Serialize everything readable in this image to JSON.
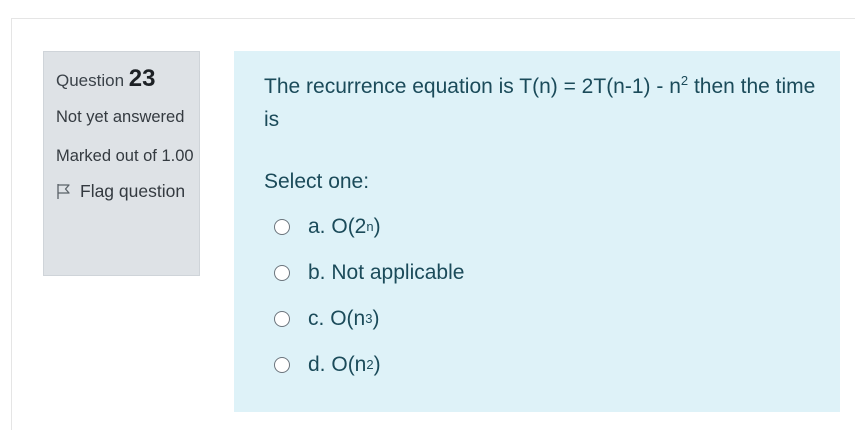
{
  "info": {
    "question_label": "Question",
    "question_number": "23",
    "state": "Not yet answered",
    "grade": "Marked out of 1.00",
    "flag_label": "Flag question"
  },
  "question": {
    "text_before": "The recurrence equation is T(n) = 2T(n-1) - n",
    "text_exponent": "2",
    "text_after": " then the time is",
    "prompt": "Select one:",
    "options": [
      {
        "letter": "a.",
        "base": "O(2",
        "exponent": "n",
        "closing": ")"
      },
      {
        "letter": "b.",
        "base": "Not applicable",
        "exponent": "",
        "closing": ""
      },
      {
        "letter": "c.",
        "base": "O(n",
        "exponent": "3",
        "closing": ")"
      },
      {
        "letter": "d.",
        "base": "O(n",
        "exponent": "2",
        "closing": ")"
      }
    ]
  },
  "colors": {
    "info_bg": "#dee2e6",
    "content_bg": "#def2f8",
    "text": "#1b4b5a"
  },
  "icons": {
    "flag": "flag-icon",
    "radio": "radio-icon"
  }
}
